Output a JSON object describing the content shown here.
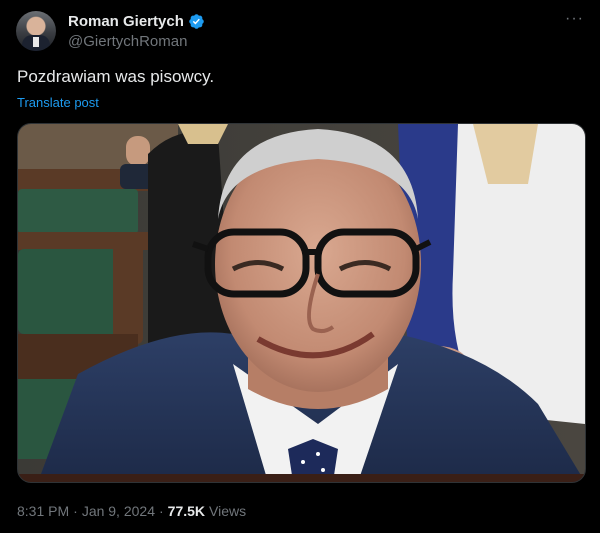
{
  "author": {
    "name": "Roman Giertych",
    "handle": "@GiertychRoman",
    "verified": true
  },
  "post": {
    "text": "Pozdrawiam was pisowcy.",
    "translate_label": "Translate post",
    "time": "8:31 PM",
    "separator": "·",
    "date": "Jan 9, 2024",
    "views_count": "77.5K",
    "views_label": "Views"
  },
  "menu": {
    "more_icon": "···"
  },
  "colors": {
    "background": "#000000",
    "text": "#e7e9ea",
    "secondary": "#71767b",
    "link": "#1d9bf0"
  }
}
